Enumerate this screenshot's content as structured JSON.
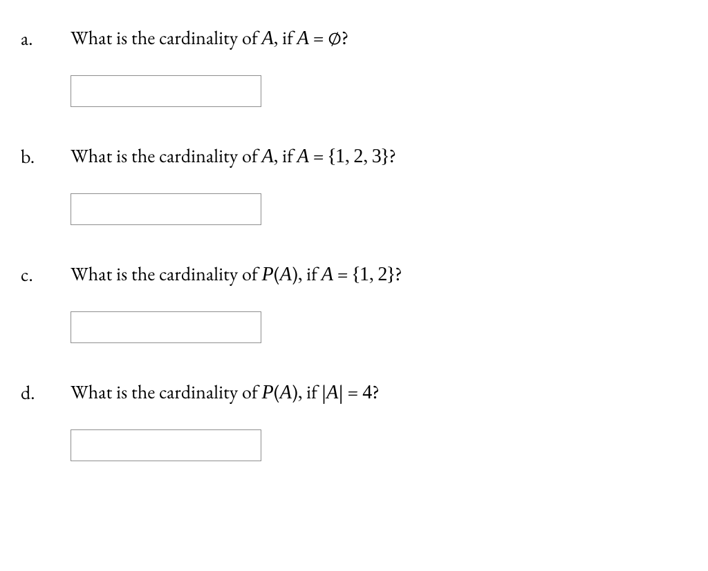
{
  "questions": [
    {
      "label": "a.",
      "text_pre": "What is the cardinality of ",
      "subject_html": "<span class='mi'>A</span>",
      "text_mid": ", if ",
      "condition_html": "<span class='mi'>A</span> = ∅",
      "text_post": "?",
      "answer": ""
    },
    {
      "label": "b.",
      "text_pre": "What is the cardinality of ",
      "subject_html": "<span class='mi'>A</span>",
      "text_mid": ", if ",
      "condition_html": "<span class='mi'>A</span> = {<span class='mn'>1</span>, <span class='mn'>2</span>, <span class='mn'>3</span>}",
      "text_post": "?",
      "answer": ""
    },
    {
      "label": "c.",
      "text_pre": "What is the cardinality of ",
      "subject_html": "<span class='scr'>P</span>(<span class='mi'>A</span>)",
      "text_mid": ", if ",
      "condition_html": "<span class='mi'>A</span> = {<span class='mn'>1</span>, <span class='mn'>2</span>}",
      "text_post": "?",
      "answer": ""
    },
    {
      "label": "d.",
      "text_pre": "What is the cardinality of ",
      "subject_html": "<span class='scr'>P</span>(<span class='mi'>A</span>)",
      "text_mid": ", if  ",
      "condition_html": "|<span class='mi'>A</span>| = <span class='mn'>4</span>",
      "text_post": "?",
      "answer": ""
    }
  ]
}
